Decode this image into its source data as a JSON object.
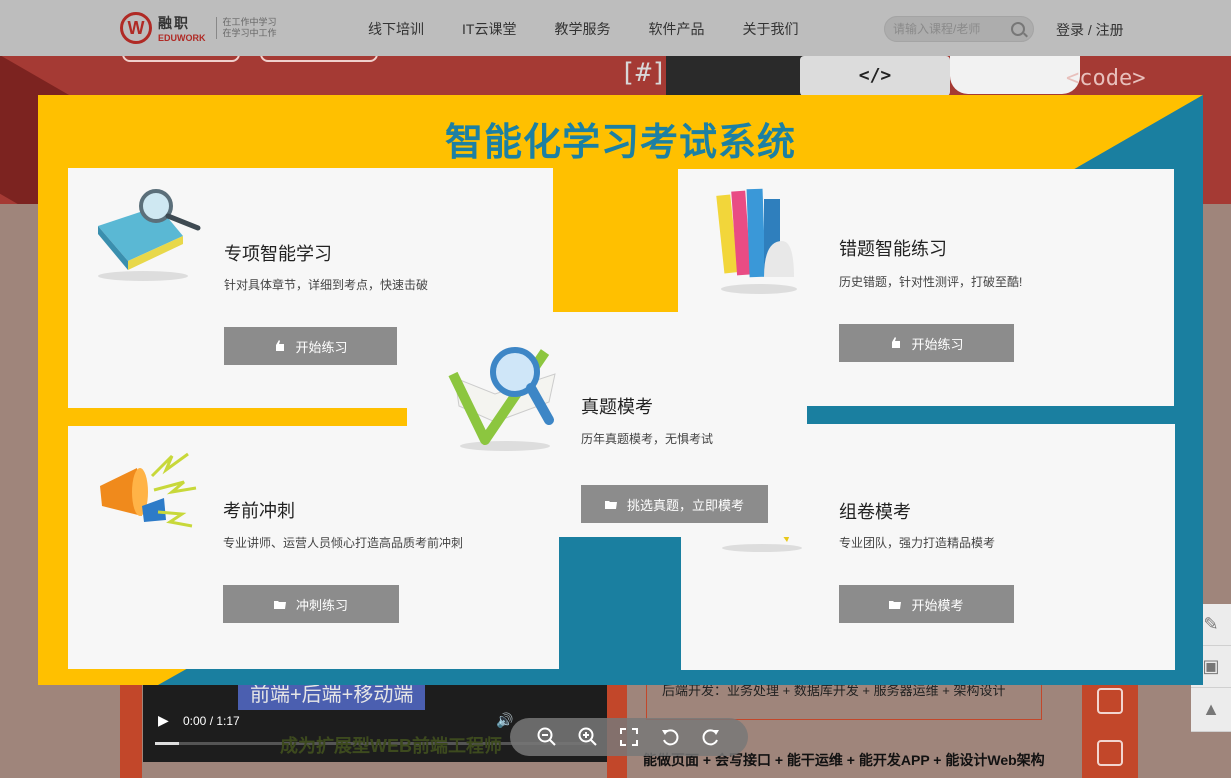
{
  "header": {
    "logo_mark": "W",
    "logo_cn": "融职",
    "logo_en": "EDUWORK",
    "slogan_line1": "在工作中学习",
    "slogan_line2": "在学习中工作",
    "nav": [
      "线下培训",
      "IT云课堂",
      "教学服务",
      "软件产品",
      "关于我们"
    ],
    "search_placeholder": "请输入课程/老师",
    "auth_label": "登录 / 注册"
  },
  "hero": {
    "code_hash": "[#]",
    "code_tag": "</>",
    "code_word": "<code>"
  },
  "video": {
    "banner": "前端+后端+移动端",
    "time": "0:00 / 1:17",
    "caption": "成为扩展型WEB前端工程师"
  },
  "tech": {
    "line1": "后端开发：业务处理 + 数据库开发 + 服务器运维 + 架构设计",
    "line2": "能做页面 + 会写接口 + 能干运维 + 能开发APP + 能设计Web架构"
  },
  "poster": {
    "title": "智能化学习考试系统",
    "colors": {
      "yellow": "#ffc000",
      "teal": "#1a7fa0",
      "button": "#8c8c8c"
    },
    "cards": [
      {
        "title": "专项智能学习",
        "desc": "针对具体章节，详细到考点，快速击破",
        "button": "开始练习",
        "icon": "magnifier-book-icon",
        "btn_icon": "thumb-icon"
      },
      {
        "title": "错题智能练习",
        "desc": "历史错题，针对性测评，打破至酷!",
        "button": "开始练习",
        "icon": "books-icon",
        "btn_icon": "thumb-icon"
      },
      {
        "title": "真题模考",
        "desc": "历年真题模考，无惧考试",
        "button": "挑选真题，立即模考",
        "icon": "checkmark-magnifier-icon",
        "btn_icon": "folder-icon"
      },
      {
        "title": "考前冲刺",
        "desc": "专业讲师、运营人员倾心打造高品质考前冲刺",
        "button": "冲刺练习",
        "icon": "megaphone-icon",
        "btn_icon": "folder-icon"
      },
      {
        "title": "组卷模考",
        "desc": "专业团队，强力打造精品模考",
        "button": "开始模考",
        "icon": "exam-icon",
        "btn_icon": "folder-icon"
      }
    ]
  },
  "viewer_controls": [
    "zoom-out-icon",
    "zoom-in-icon",
    "fullscreen-icon",
    "rotate-left-icon",
    "rotate-right-icon"
  ]
}
